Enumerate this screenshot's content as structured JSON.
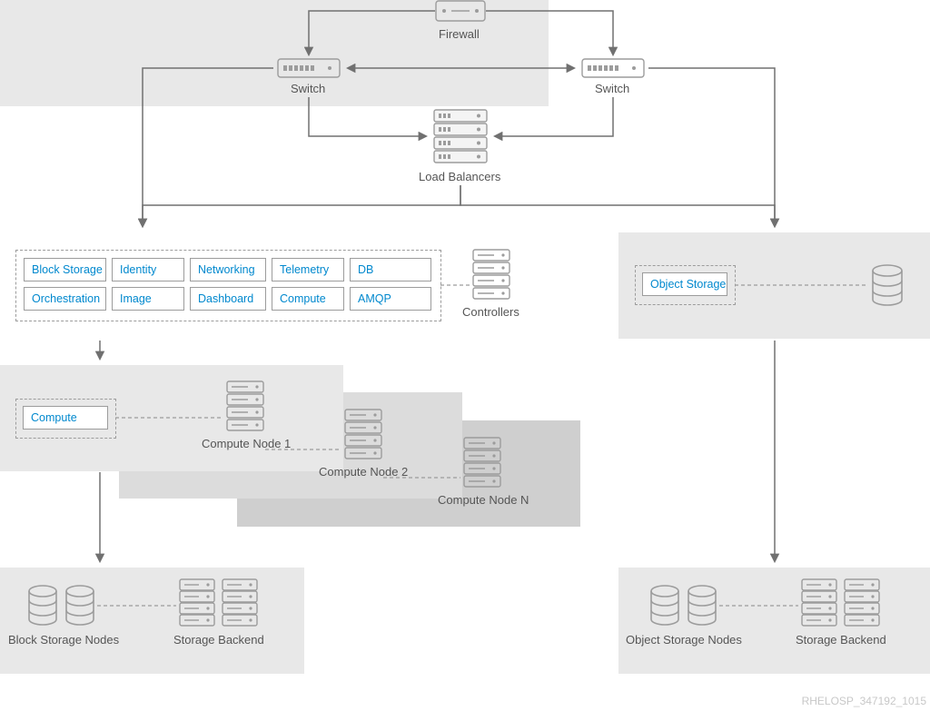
{
  "document_id": "RHELOSP_347192_1015",
  "labels": {
    "firewall": "Firewall",
    "switch_left": "Switch",
    "switch_right": "Switch",
    "load_balancers": "Load Balancers",
    "controllers": "Controllers",
    "object_storage": "Object Storage",
    "compute_single": "Compute",
    "compute_node_1": "Compute Node 1",
    "compute_node_2": "Compute Node 2",
    "compute_node_n": "Compute Node N",
    "block_storage_nodes": "Block Storage Nodes",
    "storage_backend_left": "Storage Backend",
    "object_storage_nodes": "Object Storage Nodes",
    "storage_backend_right": "Storage Backend"
  },
  "controller_services": {
    "row1": [
      "Block Storage",
      "Identity",
      "Networking",
      "Telemetry",
      "DB"
    ],
    "row2": [
      "Orchestration",
      "Image",
      "Dashboard",
      "Compute",
      "AMQP"
    ]
  }
}
